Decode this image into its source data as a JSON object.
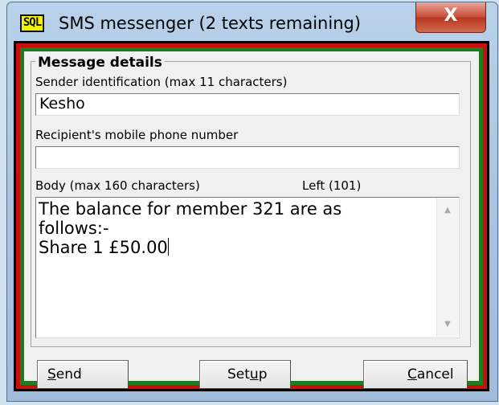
{
  "window": {
    "title": "SMS messenger (2 texts remaining)",
    "icon_text": "SQL",
    "close_glyph": "X",
    "border_colors": {
      "outer": "#000000",
      "middle": "#c8100c",
      "inner": "#1f7c1f"
    }
  },
  "group": {
    "title": "Message details"
  },
  "sender": {
    "label": "Sender identification (max 11 characters)",
    "value": "Kesho"
  },
  "recipient": {
    "label": "Recipient's mobile phone number",
    "value": ""
  },
  "body": {
    "label": "Body (max 160 characters)",
    "left_label": "Left (101)",
    "value": "The balance for member 321 are as\nfollows:-\nShare 1 £50.00"
  },
  "buttons": {
    "send": {
      "accel": "S",
      "rest": "end"
    },
    "setup": {
      "pre": "Set",
      "accel": "u",
      "rest": "p"
    },
    "cancel": {
      "accel": "C",
      "rest": "ancel"
    }
  }
}
